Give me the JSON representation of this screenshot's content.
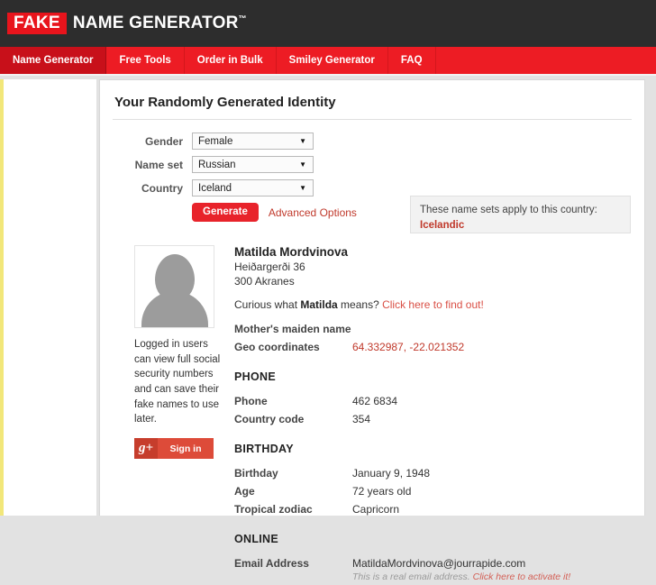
{
  "header": {
    "logo_badge": "FAKE",
    "logo_text": "NAME GENERATOR",
    "logo_tm": "™"
  },
  "nav": {
    "items": [
      {
        "label": "Name Generator",
        "active": true
      },
      {
        "label": "Free Tools",
        "active": false
      },
      {
        "label": "Order in Bulk",
        "active": false
      },
      {
        "label": "Smiley Generator",
        "active": false
      },
      {
        "label": "FAQ",
        "active": false
      }
    ]
  },
  "card": {
    "title": "Your Randomly Generated Identity"
  },
  "form": {
    "gender": {
      "label": "Gender",
      "value": "Female"
    },
    "nameset": {
      "label": "Name set",
      "value": "Russian"
    },
    "country": {
      "label": "Country",
      "value": "Iceland"
    },
    "generate_label": "Generate",
    "advanced_label": "Advanced Options",
    "arrow_glyph": "▼"
  },
  "info_box": {
    "line1": "These name sets apply to this country:",
    "language": "Icelandic"
  },
  "sidebar": {
    "logged_in_text": "Logged in users can view full social security numbers and can save their fake names to use later.",
    "gplus_glyph": "g+",
    "signin_label": "Sign in"
  },
  "identity": {
    "name": "Matilda Mordvinova",
    "address_line1": "Heiðargerði 36",
    "address_line2": "300 Akranes",
    "curious_prefix": "Curious what ",
    "curious_name": "Matilda",
    "curious_suffix": " means? ",
    "curious_link": "Click here to find out!",
    "rows": [
      {
        "key": "Mother's maiden name",
        "value": "",
        "red": false
      },
      {
        "key": "Geo coordinates",
        "value": "64.332987, -22.021352",
        "red": true
      }
    ]
  },
  "phone": {
    "heading": "PHONE",
    "rows": [
      {
        "key": "Phone",
        "value": "462 6834"
      },
      {
        "key": "Country code",
        "value": "354"
      }
    ]
  },
  "birthday": {
    "heading": "BIRTHDAY",
    "rows": [
      {
        "key": "Birthday",
        "value": "January 9, 1948"
      },
      {
        "key": "Age",
        "value": "72 years old"
      },
      {
        "key": "Tropical zodiac",
        "value": "Capricorn"
      }
    ]
  },
  "online": {
    "heading": "ONLINE",
    "email_key": "Email Address",
    "email_value": "MatildaMordvinova@jourrapide.com",
    "email_note_text": "This is a real email address. ",
    "email_note_link": "Click here to activate it!"
  },
  "colors": {
    "brand_red": "#ed1c24",
    "active_red": "#c8101a",
    "header_dark": "#2d2d2d",
    "link_red": "#c0392b",
    "accent_yellow": "#f2e77a"
  }
}
